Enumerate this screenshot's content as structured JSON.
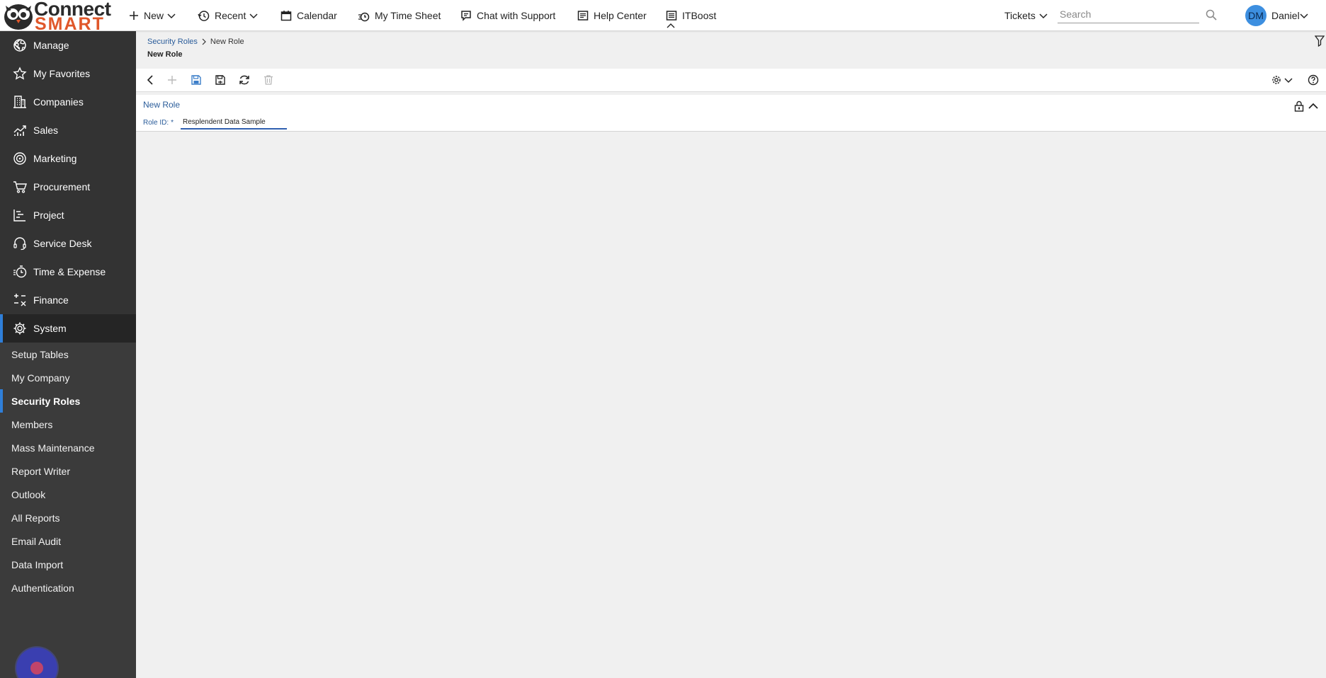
{
  "app": {
    "logo_line1": "Connect",
    "logo_line2": "SMART"
  },
  "topnav": {
    "items": [
      {
        "label": "New",
        "icon": "plus-icon"
      },
      {
        "label": "Recent",
        "icon": "history-icon"
      },
      {
        "label": "Calendar",
        "icon": "calendar-icon"
      },
      {
        "label": "My Time Sheet",
        "icon": "stopwatch-icon"
      },
      {
        "label": "Chat with Support",
        "icon": "chat-icon"
      },
      {
        "label": "Help Center",
        "icon": "document-icon"
      },
      {
        "label": "ITBoost",
        "icon": "list-icon"
      }
    ],
    "tickets_label": "Tickets",
    "search_placeholder": "Search",
    "user_initials": "DM",
    "user_name": "Daniel"
  },
  "sidebar": {
    "main": [
      {
        "label": "Manage",
        "icon": "globe-icon"
      },
      {
        "label": "My Favorites",
        "icon": "star-icon"
      },
      {
        "label": "Companies",
        "icon": "building-icon"
      },
      {
        "label": "Sales",
        "icon": "chart-icon"
      },
      {
        "label": "Marketing",
        "icon": "target-icon"
      },
      {
        "label": "Procurement",
        "icon": "cart-icon"
      },
      {
        "label": "Project",
        "icon": "gantt-icon"
      },
      {
        "label": "Service Desk",
        "icon": "headset-icon"
      },
      {
        "label": "Time & Expense",
        "icon": "timer-icon"
      },
      {
        "label": "Finance",
        "icon": "calculator-icon"
      },
      {
        "label": "System",
        "icon": "gear-icon",
        "active": true
      }
    ],
    "sub": [
      {
        "label": "Setup Tables"
      },
      {
        "label": "My Company"
      },
      {
        "label": "Security Roles",
        "active": true
      },
      {
        "label": "Members"
      },
      {
        "label": "Mass Maintenance"
      },
      {
        "label": "Report Writer"
      },
      {
        "label": "Outlook"
      },
      {
        "label": "All Reports"
      },
      {
        "label": "Email Audit"
      },
      {
        "label": "Data Import"
      },
      {
        "label": "Authentication"
      }
    ]
  },
  "breadcrumb": {
    "parent": "Security Roles",
    "current": "New Role"
  },
  "page": {
    "title": "New Role"
  },
  "form": {
    "section_title": "New Role",
    "role_id_label": "Role ID:",
    "required_mark": "*",
    "role_id_value": "Resplendent Data Sample"
  },
  "colors": {
    "sidebar_bg": "#333333",
    "accent_blue": "#2f7fd9",
    "link_blue": "#2a5c9a",
    "logo_orange": "#e0572a"
  }
}
